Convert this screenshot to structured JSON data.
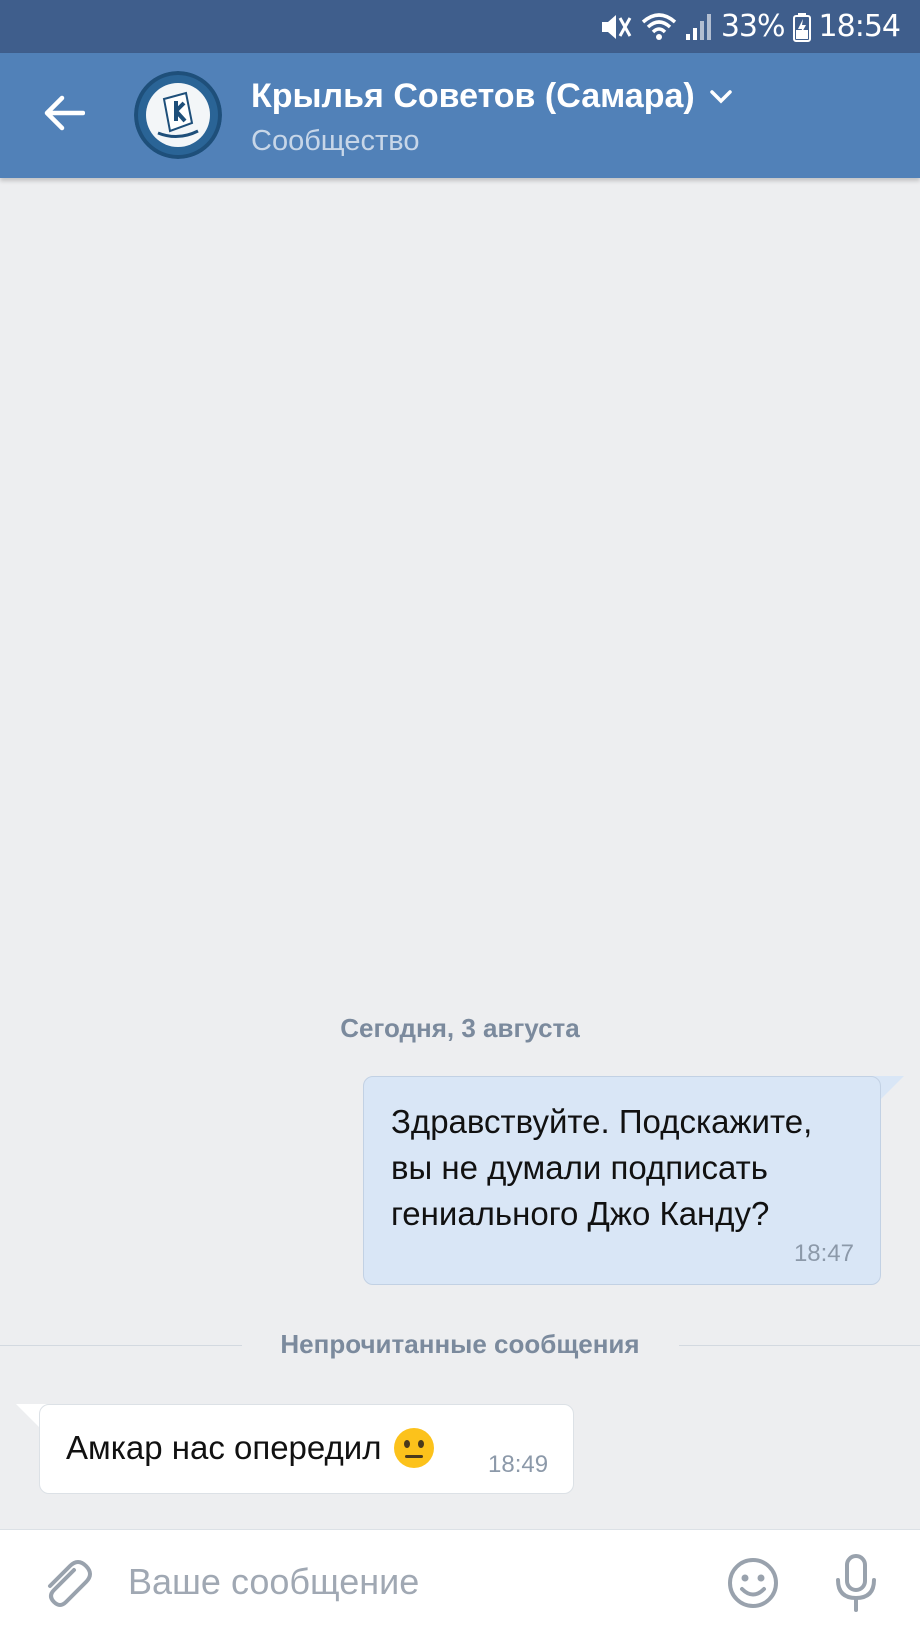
{
  "status_bar": {
    "battery": "33%",
    "time": "18:54"
  },
  "header": {
    "title": "Крылья Советов (Самара)",
    "subtitle": "Сообщество"
  },
  "chat": {
    "date_separator": "Сегодня, 3 августа",
    "outgoing": {
      "lines": [
        "Здравствуйте. Подскажите,",
        "вы не думали подписать",
        "гениального Джо Канду?"
      ],
      "time": "18:47"
    },
    "unread_separator": "Непрочитанные сообщения",
    "incoming": {
      "text": "Амкар нас опередил",
      "emoji": "neutral-face-emoji",
      "time": "18:49"
    }
  },
  "input": {
    "placeholder": "Ваше сообщение"
  },
  "colors": {
    "header": "#5181b8",
    "status_bar": "#3f5e8c",
    "background": "#edeef0",
    "outgoing_bubble": "#d9e6f6",
    "incoming_bubble": "#ffffff",
    "icon_gray": "#99a2ad"
  }
}
